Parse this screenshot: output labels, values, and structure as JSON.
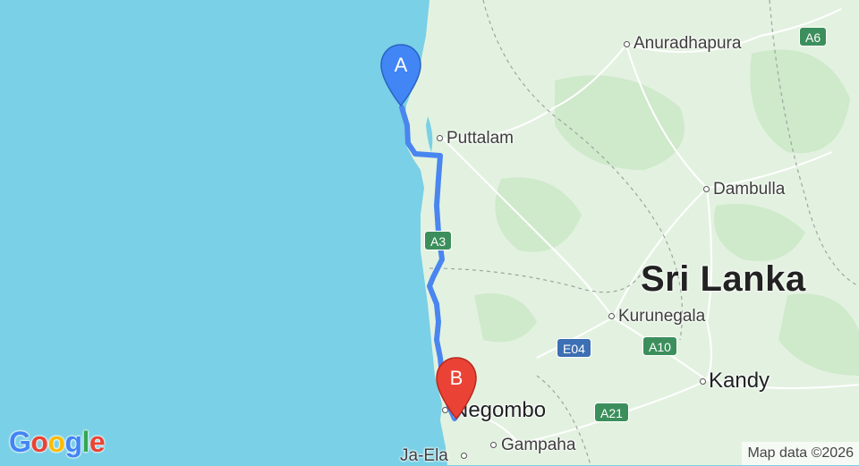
{
  "map": {
    "country_label": "Sri Lanka",
    "cities": [
      {
        "id": "anuradhapura",
        "name": "Anuradhapura"
      },
      {
        "id": "puttalam",
        "name": "Puttalam"
      },
      {
        "id": "dambulla",
        "name": "Dambulla"
      },
      {
        "id": "kurunegala",
        "name": "Kurunegala"
      },
      {
        "id": "kandy",
        "name": "Kandy"
      },
      {
        "id": "negombo",
        "name": "Negombo"
      },
      {
        "id": "gampaha",
        "name": "Gampaha"
      },
      {
        "id": "ja-ela",
        "name": "Ja-Ela"
      }
    ],
    "road_shields": [
      {
        "id": "a6",
        "label": "A6",
        "type": "green"
      },
      {
        "id": "a3",
        "label": "A3",
        "type": "green"
      },
      {
        "id": "a10",
        "label": "A10",
        "type": "green"
      },
      {
        "id": "a21",
        "label": "A21",
        "type": "green"
      },
      {
        "id": "e04",
        "label": "E04",
        "type": "blue"
      }
    ],
    "markers": {
      "start": {
        "letter": "A",
        "color": "#4285f4"
      },
      "end": {
        "letter": "B",
        "color": "#ea4335"
      }
    },
    "route_color": "#4a86f0",
    "attribution": "Map data ©2026",
    "logo": "Google"
  }
}
